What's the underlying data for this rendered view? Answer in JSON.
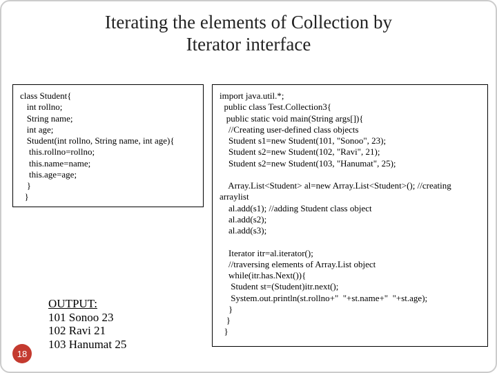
{
  "title": "Iterating the elements of Collection by\nIterator interface",
  "left_code": "class Student{\n   int rollno;\n   String name;\n   int age;\n   Student(int rollno, String name, int age){\n    this.rollno=rollno;\n    this.name=name;\n    this.age=age;\n   }\n  }",
  "right_code": "import java.util.*;\n  public class Test.Collection3{\n   public static void main(String args[]){\n    //Creating user-defined class objects\n    Student s1=new Student(101, \"Sonoo\", 23);\n    Student s2=new Student(102, \"Ravi\", 21);\n    Student s2=new Student(103, \"Hanumat\", 25);\n\n    Array.List<Student> al=new Array.List<Student>(); //creating\narraylist\n    al.add(s1); //adding Student class object\n    al.add(s2);\n    al.add(s3);\n\n    Iterator itr=al.iterator();\n    //traversing elements of Array.List object\n    while(itr.has.Next()){\n     Student st=(Student)itr.next();\n     System.out.println(st.rollno+\"  \"+st.name+\"  \"+st.age);\n    }\n   }\n  }",
  "output": {
    "label": "OUTPUT:",
    "lines": [
      "101 Sonoo 23",
      "102 Ravi 21",
      "103 Hanumat 25"
    ]
  },
  "page_number": "18"
}
